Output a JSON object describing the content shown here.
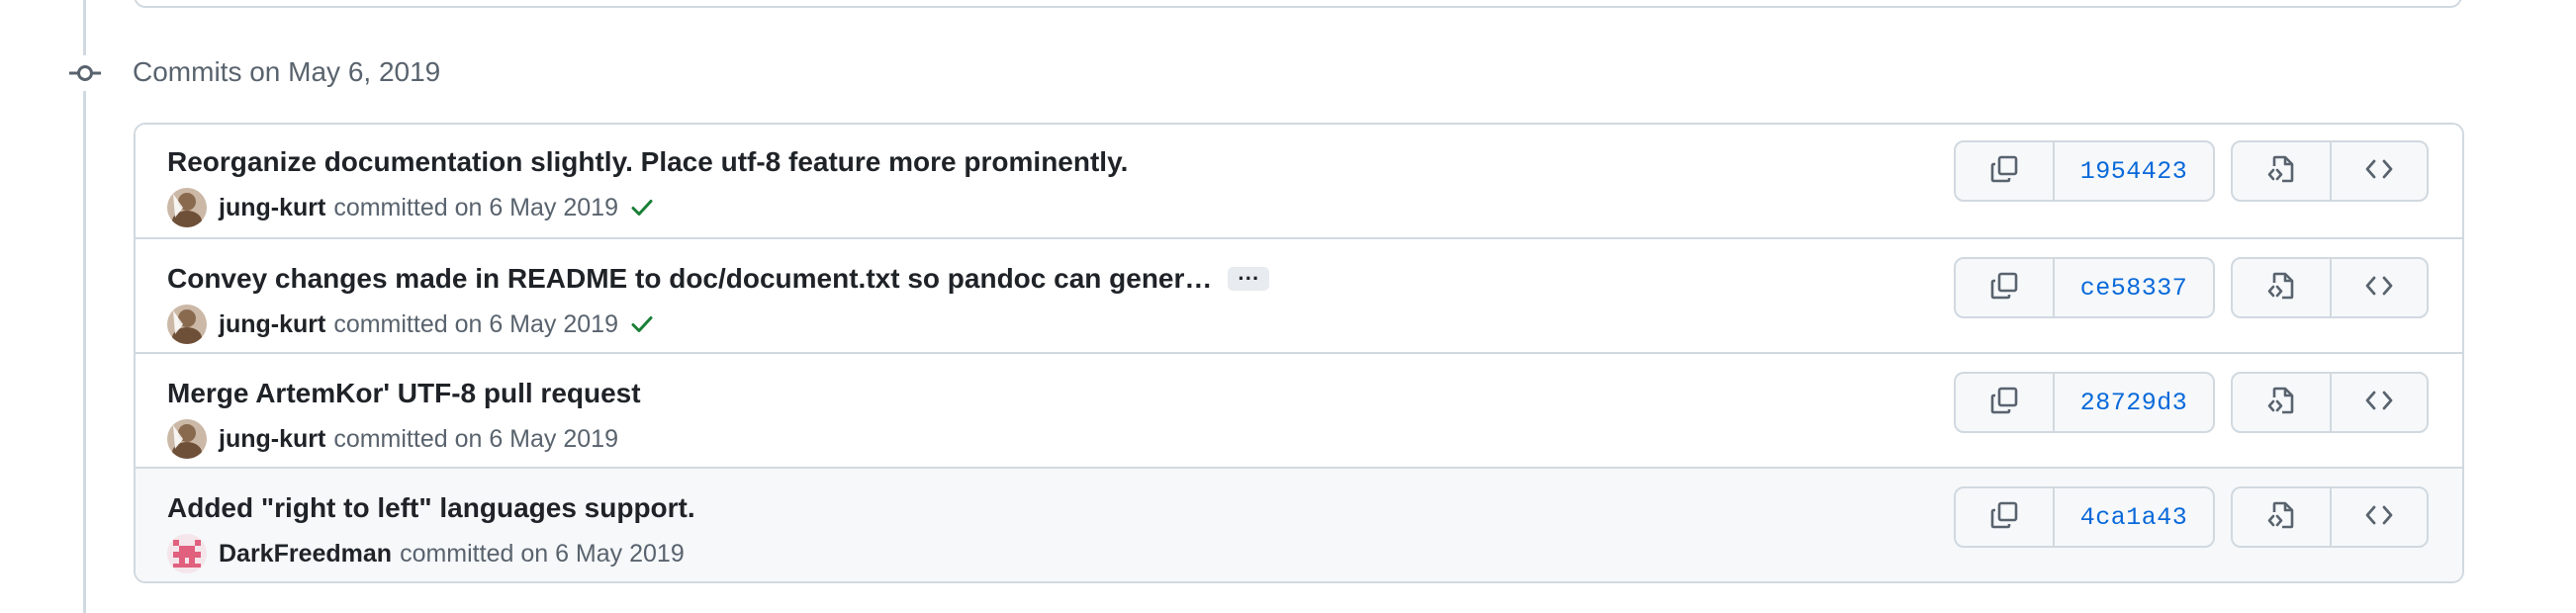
{
  "group": {
    "title": "Commits on May 6, 2019"
  },
  "commits": [
    {
      "title": "Reorganize documentation slightly. Place utf-8 feature more prominently.",
      "author": "jung-kurt",
      "meta_text": "committed on 6 May 2019",
      "status": "success",
      "sha": "1954423"
    },
    {
      "title": "Convey changes made in README to doc/document.txt so pandoc can gener…",
      "ellipsis": "···",
      "author": "jung-kurt",
      "meta_text": "committed on 6 May 2019",
      "status": "success",
      "sha": "ce58337"
    },
    {
      "title": "Merge ArtemKor' UTF-8 pull request",
      "author": "jung-kurt",
      "meta_text": "committed on 6 May 2019",
      "sha": "28729d3"
    },
    {
      "title": "Added \"right to left\" languages support.",
      "author": "DarkFreedman",
      "meta_text": "committed on 6 May 2019",
      "sha": "4ca1a43"
    }
  ],
  "colors": {
    "link": "#0969da",
    "success": "#1a7f37",
    "border": "#d1d9e0",
    "muted": "#59636e"
  },
  "icons": {
    "timeline": "git-commit-icon",
    "copy": "copy-icon",
    "browse_files": "file-code-icon",
    "browse_repo": "code-icon",
    "status": "check-icon"
  }
}
